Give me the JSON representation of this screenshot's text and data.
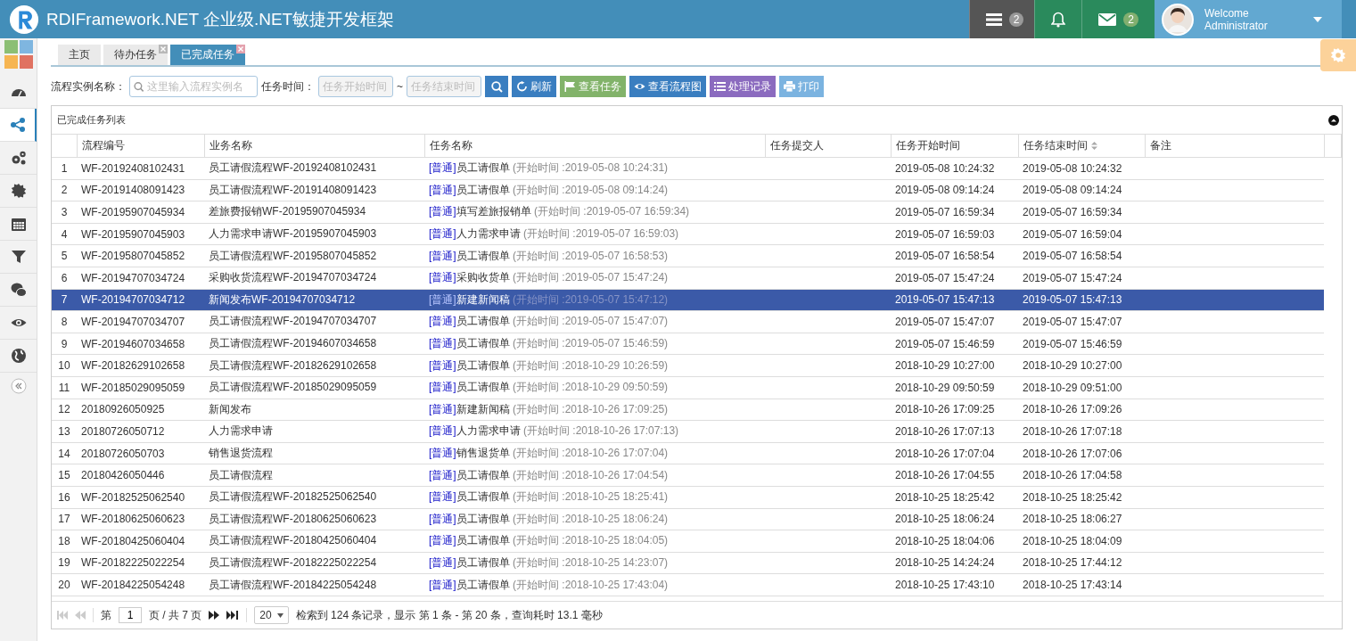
{
  "header": {
    "title": "RDIFramework.NET 企业级.NET敏捷开发框架",
    "tasks_badge": "2",
    "messages_badge": "2",
    "welcome": "Welcome",
    "user": "Administrator"
  },
  "sidebar": {
    "items": [
      {
        "selected": false
      },
      {
        "selected": true
      },
      {
        "selected": false
      },
      {
        "selected": false
      },
      {
        "selected": false
      },
      {
        "selected": false
      },
      {
        "selected": false
      },
      {
        "selected": false
      },
      {
        "selected": false
      }
    ]
  },
  "tabs": [
    {
      "label": "主页",
      "selected": false,
      "closable": false
    },
    {
      "label": "待办任务",
      "selected": false,
      "closable": true
    },
    {
      "label": "已完成任务",
      "selected": true,
      "closable": true
    }
  ],
  "toolbar": {
    "name_label": "流程实例名称：",
    "name_placeholder": "这里输入流程实例名",
    "time_label": "任务时间：",
    "start_placeholder": "任务开始时间",
    "separator": "~",
    "end_placeholder": "任务结束时间",
    "buttons": [
      {
        "label": "刷新",
        "kind": "refresh",
        "color": "#3a7ec0"
      },
      {
        "label": "查看任务",
        "kind": "flag",
        "color": "#82b36a"
      },
      {
        "label": "查看流程图",
        "kind": "eye",
        "color": "#3a7ec0"
      },
      {
        "label": "处理记录",
        "kind": "list",
        "color": "#8b6bbf"
      },
      {
        "label": "打印",
        "kind": "print",
        "color": "#7bb3e0"
      }
    ]
  },
  "grid": {
    "title": "已完成任务列表",
    "columns": [
      "流程编号",
      "业务名称",
      "任务名称",
      "任务提交人",
      "任务开始时间",
      "任务结束时间",
      "备注"
    ],
    "rows": [
      {
        "num": "1",
        "code": "WF-20192408102431",
        "business": "员工请假流程WF-20192408102431",
        "tag": "[普通]",
        "task": "员工请假单",
        "note": "(开始时间 :2019-05-08 10:24:31)",
        "start": "2019-05-08 10:24:32",
        "end": "2019-05-08 10:24:32",
        "selected": false
      },
      {
        "num": "2",
        "code": "WF-20191408091423",
        "business": "员工请假流程WF-20191408091423",
        "tag": "[普通]",
        "task": "员工请假单",
        "note": "(开始时间 :2019-05-08 09:14:24)",
        "start": "2019-05-08 09:14:24",
        "end": "2019-05-08 09:14:24",
        "selected": false
      },
      {
        "num": "3",
        "code": "WF-20195907045934",
        "business": "差旅费报销WF-20195907045934",
        "tag": "[普通]",
        "task": "填写差旅报销单",
        "note": "(开始时间 :2019-05-07 16:59:34)",
        "start": "2019-05-07 16:59:34",
        "end": "2019-05-07 16:59:34",
        "selected": false
      },
      {
        "num": "4",
        "code": "WF-20195907045903",
        "business": "人力需求申请WF-20195907045903",
        "tag": "[普通]",
        "task": "人力需求申请",
        "note": "(开始时间 :2019-05-07 16:59:03)",
        "start": "2019-05-07 16:59:03",
        "end": "2019-05-07 16:59:04",
        "selected": false
      },
      {
        "num": "5",
        "code": "WF-20195807045852",
        "business": "员工请假流程WF-20195807045852",
        "tag": "[普通]",
        "task": "员工请假单",
        "note": "(开始时间 :2019-05-07 16:58:53)",
        "start": "2019-05-07 16:58:54",
        "end": "2019-05-07 16:58:54",
        "selected": false
      },
      {
        "num": "6",
        "code": "WF-20194707034724",
        "business": "采购收货流程WF-20194707034724",
        "tag": "[普通]",
        "task": "采购收货单",
        "note": "(开始时间 :2019-05-07 15:47:24)",
        "start": "2019-05-07 15:47:24",
        "end": "2019-05-07 15:47:24",
        "selected": false
      },
      {
        "num": "7",
        "code": "WF-20194707034712",
        "business": "新闻发布WF-20194707034712",
        "tag": "[普通]",
        "task": "新建新闻稿",
        "note": "(开始时间 :2019-05-07 15:47:12)",
        "start": "2019-05-07 15:47:13",
        "end": "2019-05-07 15:47:13",
        "selected": true
      },
      {
        "num": "8",
        "code": "WF-20194707034707",
        "business": "员工请假流程WF-20194707034707",
        "tag": "[普通]",
        "task": "员工请假单",
        "note": "(开始时间 :2019-05-07 15:47:07)",
        "start": "2019-05-07 15:47:07",
        "end": "2019-05-07 15:47:07",
        "selected": false
      },
      {
        "num": "9",
        "code": "WF-20194607034658",
        "business": "员工请假流程WF-20194607034658",
        "tag": "[普通]",
        "task": "员工请假单",
        "note": "(开始时间 :2019-05-07 15:46:59)",
        "start": "2019-05-07 15:46:59",
        "end": "2019-05-07 15:46:59",
        "selected": false
      },
      {
        "num": "10",
        "code": "WF-20182629102658",
        "business": "员工请假流程WF-20182629102658",
        "tag": "[普通]",
        "task": "员工请假单",
        "note": "(开始时间 :2018-10-29 10:26:59)",
        "start": "2018-10-29 10:27:00",
        "end": "2018-10-29 10:27:00",
        "selected": false
      },
      {
        "num": "11",
        "code": "WF-20185029095059",
        "business": "员工请假流程WF-20185029095059",
        "tag": "[普通]",
        "task": "员工请假单",
        "note": "(开始时间 :2018-10-29 09:50:59)",
        "start": "2018-10-29 09:50:59",
        "end": "2018-10-29 09:51:00",
        "selected": false
      },
      {
        "num": "12",
        "code": "20180926050925",
        "business": "新闻发布",
        "tag": "[普通]",
        "task": "新建新闻稿",
        "note": "(开始时间 :2018-10-26 17:09:25)",
        "start": "2018-10-26 17:09:25",
        "end": "2018-10-26 17:09:26",
        "selected": false
      },
      {
        "num": "13",
        "code": "20180726050712",
        "business": "人力需求申请",
        "tag": "[普通]",
        "task": "人力需求申请",
        "note": "(开始时间 :2018-10-26 17:07:13)",
        "start": "2018-10-26 17:07:13",
        "end": "2018-10-26 17:07:18",
        "selected": false
      },
      {
        "num": "14",
        "code": "20180726050703",
        "business": "销售退货流程",
        "tag": "[普通]",
        "task": "销售退货单",
        "note": "(开始时间 :2018-10-26 17:07:04)",
        "start": "2018-10-26 17:07:04",
        "end": "2018-10-26 17:07:06",
        "selected": false
      },
      {
        "num": "15",
        "code": "20180426050446",
        "business": "员工请假流程",
        "tag": "[普通]",
        "task": "员工请假单",
        "note": "(开始时间 :2018-10-26 17:04:54)",
        "start": "2018-10-26 17:04:55",
        "end": "2018-10-26 17:04:58",
        "selected": false
      },
      {
        "num": "16",
        "code": "WF-20182525062540",
        "business": "员工请假流程WF-20182525062540",
        "tag": "[普通]",
        "task": "员工请假单",
        "note": "(开始时间 :2018-10-25 18:25:41)",
        "start": "2018-10-25 18:25:42",
        "end": "2018-10-25 18:25:42",
        "selected": false
      },
      {
        "num": "17",
        "code": "WF-20180625060623",
        "business": "员工请假流程WF-20180625060623",
        "tag": "[普通]",
        "task": "员工请假单",
        "note": "(开始时间 :2018-10-25 18:06:24)",
        "start": "2018-10-25 18:06:24",
        "end": "2018-10-25 18:06:27",
        "selected": false
      },
      {
        "num": "18",
        "code": "WF-20180425060404",
        "business": "员工请假流程WF-20180425060404",
        "tag": "[普通]",
        "task": "员工请假单",
        "note": "(开始时间 :2018-10-25 18:04:05)",
        "start": "2018-10-25 18:04:06",
        "end": "2018-10-25 18:04:09",
        "selected": false
      },
      {
        "num": "19",
        "code": "WF-20182225022254",
        "business": "员工请假流程WF-20182225022254",
        "tag": "[普通]",
        "task": "员工请假单",
        "note": "(开始时间 :2018-10-25 14:23:07)",
        "start": "2018-10-25 14:24:24",
        "end": "2018-10-25 17:44:12",
        "selected": false
      },
      {
        "num": "20",
        "code": "WF-20184225054248",
        "business": "员工请假流程WF-20184225054248",
        "tag": "[普通]",
        "task": "员工请假单",
        "note": "(开始时间 :2018-10-25 17:43:04)",
        "start": "2018-10-25 17:43:10",
        "end": "2018-10-25 17:43:14",
        "selected": false
      }
    ]
  },
  "pager": {
    "page_prefix": "第",
    "page": "1",
    "page_suffix": "页 / 共 7 页",
    "page_size": "20",
    "info": "检索到 124 条记录，显示 第 1 条 - 第 20 条，查询耗时 13.1 毫秒"
  }
}
